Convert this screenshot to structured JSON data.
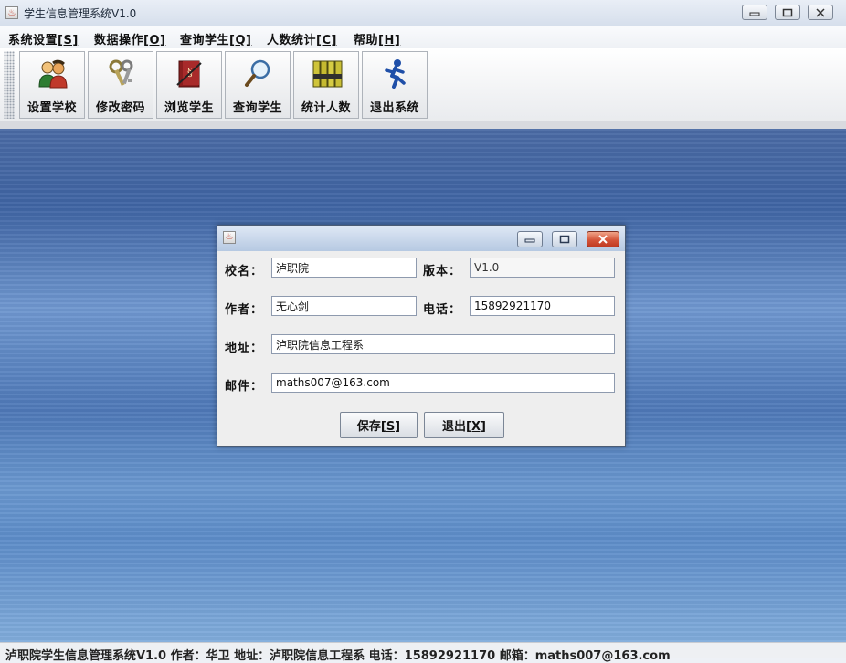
{
  "window": {
    "title": "学生信息管理系统V1.0",
    "icon": "java-cup-icon"
  },
  "menu": [
    {
      "label": "系统设置",
      "key": "[S]"
    },
    {
      "label": "数据操作",
      "key": "[O]"
    },
    {
      "label": "查询学生",
      "key": "[Q]"
    },
    {
      "label": "人数统计",
      "key": "[C]"
    },
    {
      "label": "帮助",
      "key": "[H]"
    }
  ],
  "toolbar": [
    {
      "label": "设置学校",
      "icon": "users-icon"
    },
    {
      "label": "修改密码",
      "icon": "keys-icon"
    },
    {
      "label": "浏览学生",
      "icon": "book-icon"
    },
    {
      "label": "查询学生",
      "icon": "magnifier-icon"
    },
    {
      "label": "统计人数",
      "icon": "binders-icon"
    },
    {
      "label": "退出系统",
      "icon": "running-man-icon"
    }
  ],
  "dialog": {
    "icon": "java-cup-icon",
    "fields": {
      "school": {
        "label": "校名：",
        "value": "泸职院"
      },
      "version": {
        "label": "版本：",
        "value": "V1.0"
      },
      "author": {
        "label": "作者：",
        "value": "无心剑"
      },
      "phone": {
        "label": "电话：",
        "value": "15892921170"
      },
      "address": {
        "label": "地址：",
        "value": "泸职院信息工程系"
      },
      "email": {
        "label": "邮件：",
        "value": "maths007@163.com"
      }
    },
    "buttons": {
      "save": {
        "label": "保存",
        "key": "[S]"
      },
      "exit": {
        "label": "退出",
        "key": "[X]"
      }
    }
  },
  "statusbar": {
    "text": "泸职院学生信息管理系统V1.0    作者：华卫    地址：泸职院信息工程系    电话：15892921170    邮箱：maths007@163.com"
  },
  "colors": {
    "desktop": "#4f78b6",
    "dialog_close": "#d4553a"
  }
}
